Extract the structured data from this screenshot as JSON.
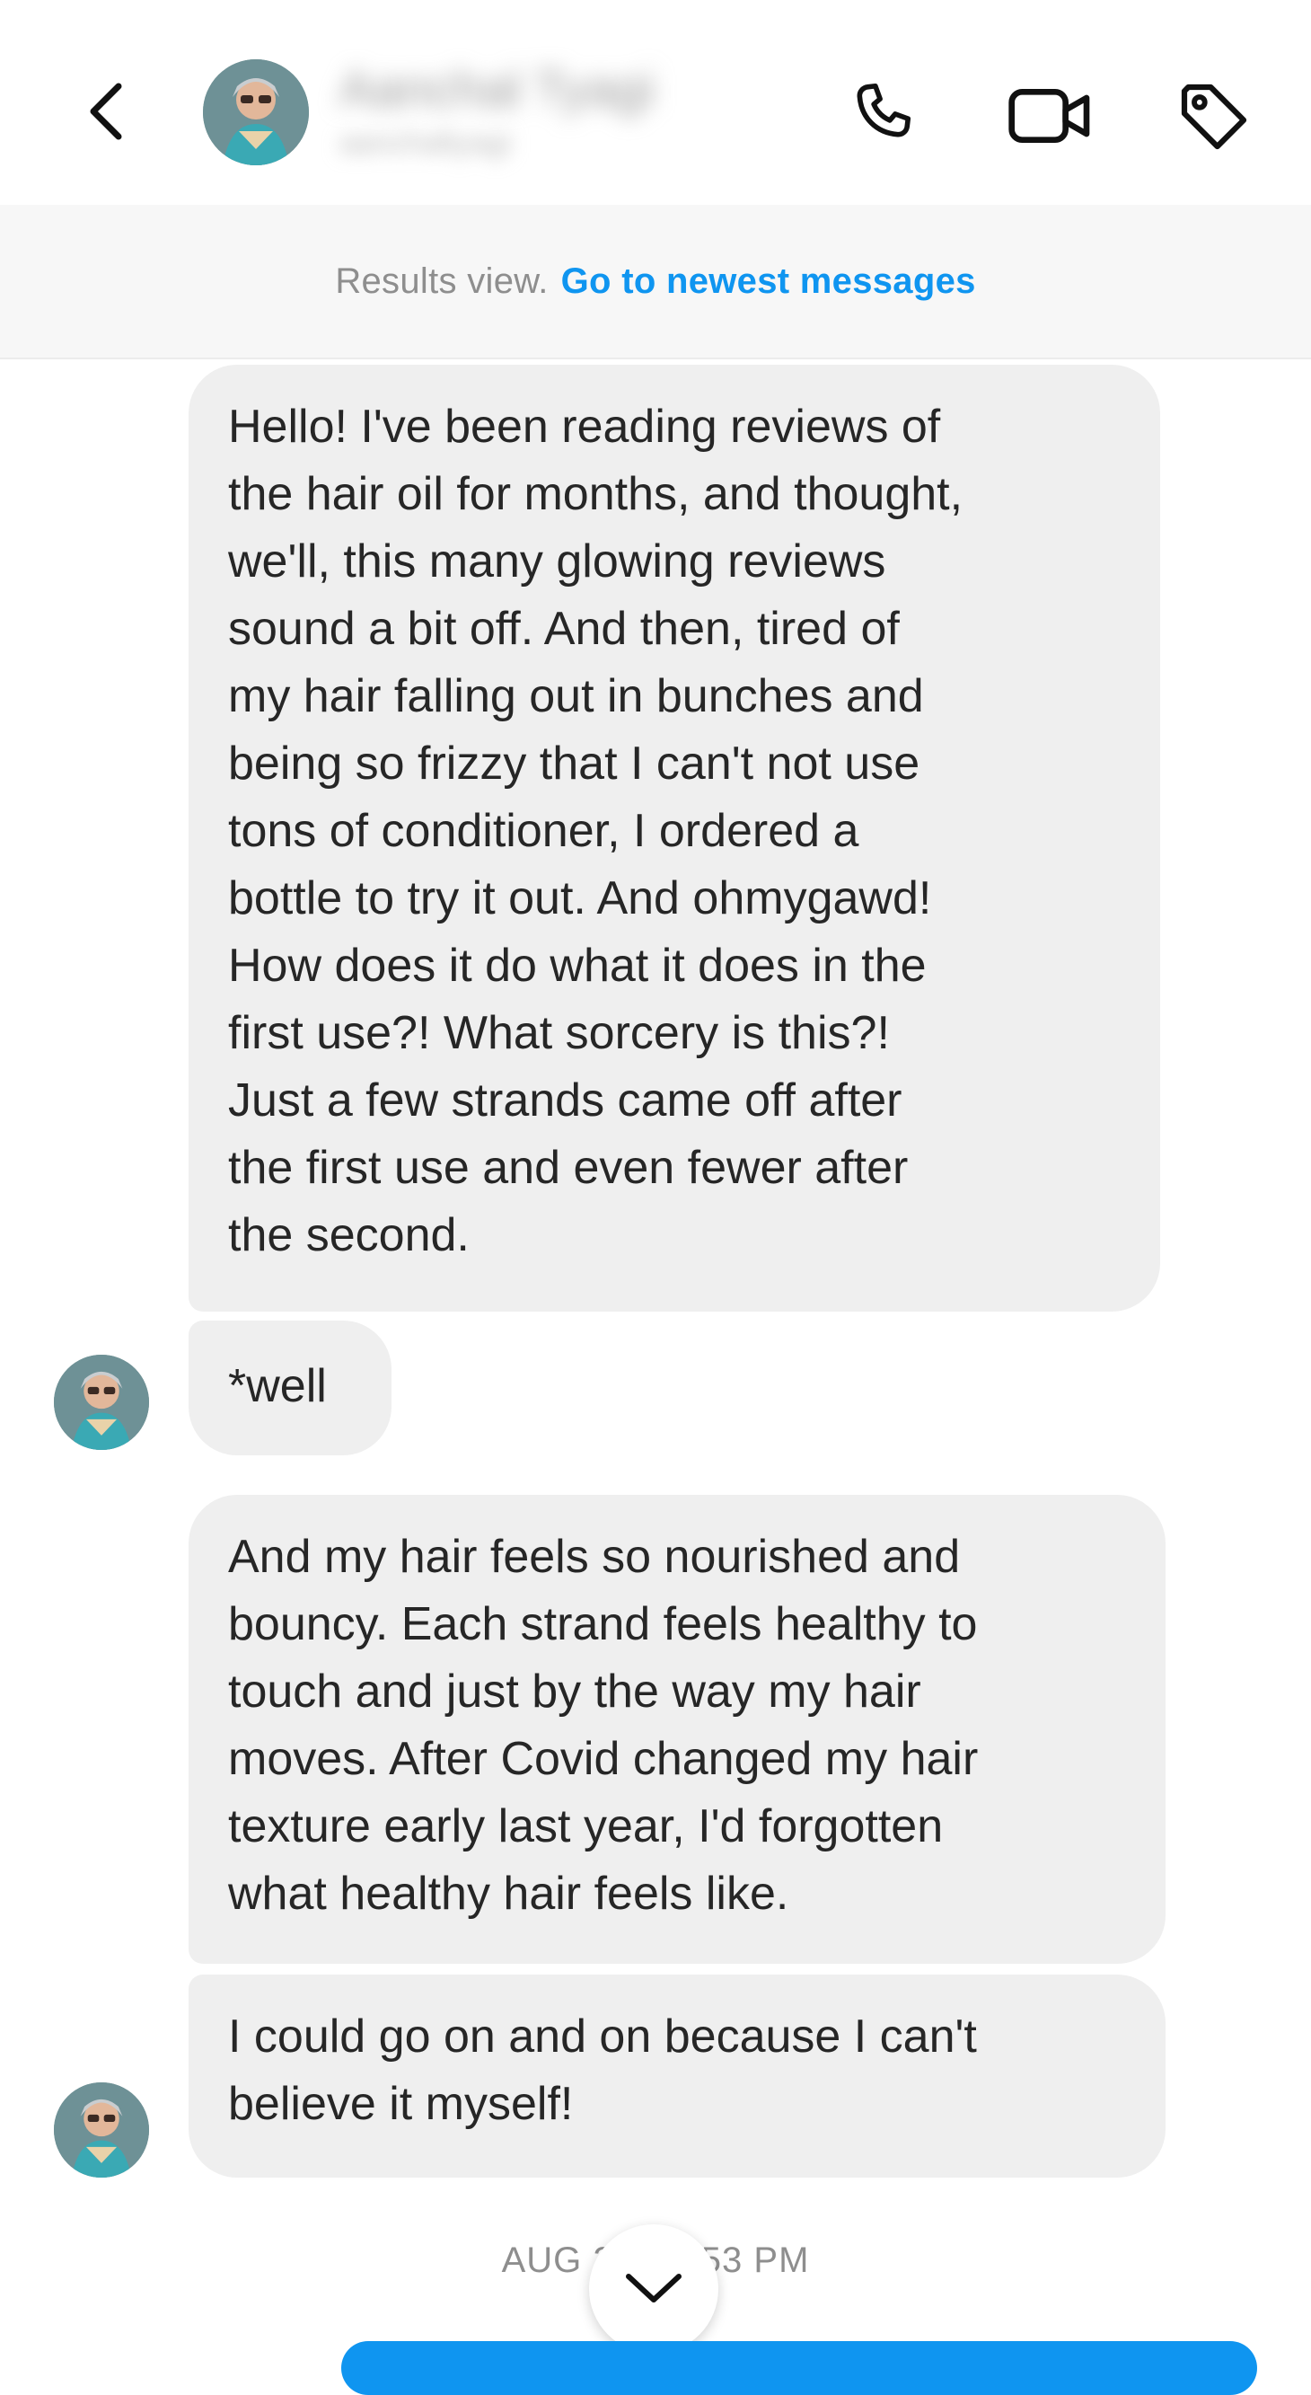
{
  "header": {
    "contact_name": "Aanchal Tyagi",
    "contact_subtitle": "aanchaltyagi",
    "icons": [
      "back-chevron-icon",
      "phone-icon",
      "video-camera-icon",
      "tag-icon"
    ]
  },
  "banner": {
    "static_text": "Results view.",
    "link_text": "Go to newest messages"
  },
  "messages": [
    {
      "text": "Hello! I've been reading reviews of\nthe hair oil for months, and thought,\nwe'll, this many glowing reviews\nsound a bit off. And then, tired of\nmy hair falling out in bunches and\nbeing so frizzy that I can't not use\ntons of conditioner, I ordered a\nbottle to try it out. And ohmygawd!\nHow does it do what it does in the\nfirst use?! What sorcery is this?!\nJust a few strands came off after\nthe first use and  even fewer after\nthe second."
    },
    {
      "text": "*well"
    },
    {
      "text": "And my hair feels so nourished and\nbouncy. Each strand feels healthy to\ntouch and just by the way my hair\nmoves. After Covid changed my hair\ntexture early last year, I'd forgotten\nwhat healthy hair feels like."
    },
    {
      "text": "I could go on and on because I can't\nbelieve it myself!"
    }
  ],
  "timestamp": "AUG 29 · 1:53 PM",
  "colors": {
    "link_blue": "#0f95f0",
    "bubble_gray": "#efefef",
    "banner_bg": "#f7f7f7"
  }
}
